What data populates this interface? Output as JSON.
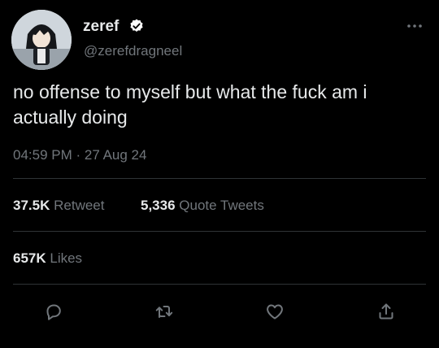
{
  "tweet": {
    "display_name": "zeref",
    "handle": "@zerefdragneel",
    "text": "no offense to myself but what the fuck am i actually doing",
    "timestamp": "04:59 PM · 27 Aug 24",
    "verified_icon": "verified-badge-icon",
    "more_icon": "more-options-icon"
  },
  "stats": {
    "retweets_count": "37.5K",
    "retweets_label": "Retweet",
    "quotes_count": "5,336",
    "quotes_label": "Quote Tweets",
    "likes_count": "657K",
    "likes_label": "Likes"
  },
  "actions": [
    {
      "icon": "reply-icon"
    },
    {
      "icon": "retweet-icon"
    },
    {
      "icon": "like-icon"
    },
    {
      "icon": "share-icon"
    }
  ],
  "colors": {
    "background": "#000000",
    "text_primary": "#e7e9ea",
    "text_secondary": "#71767b",
    "divider": "#2f3336",
    "verified": "#ffffff"
  }
}
